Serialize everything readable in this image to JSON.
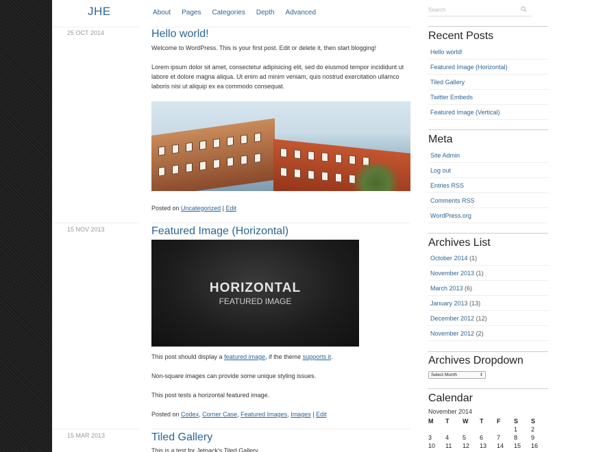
{
  "site": {
    "logo": "JHE"
  },
  "nav": [
    "About",
    "Pages",
    "Categories",
    "Depth",
    "Advanced"
  ],
  "posts": [
    {
      "date": "25 OCT 2014",
      "title": "Hello world!",
      "p1": "Welcome to WordPress. This is your first post. Edit or delete it, then start blogging!",
      "p2": "Lorem ipsum dolor sit amet, consectetur adipisicing elit, sed do eiusmod tempor incididunt ut labore et dolore magna aliqua. Ut enim ad minim veniam, quis nostrud exercitation ullamco laboris nisi ut aliquip ex ea commodo consequat.",
      "posted_on": "Posted on",
      "category": "Uncategorized",
      "sep": "|",
      "edit": "Edit"
    },
    {
      "date": "15 NOV 2013",
      "title": "Featured Image (Horizontal)",
      "image_big": "HORIZONTAL",
      "image_small": "FEATURED IMAGE",
      "p1_a": "This post should display a ",
      "p1_link1": "featured image",
      "p1_b": ", if the theme ",
      "p1_link2": "supports it",
      "p1_c": ".",
      "p2": "Non-square images can provide some unique styling issues.",
      "p3": "This post tests a horizontal featured image.",
      "posted_on": "Posted on",
      "tags": [
        "Codex",
        "Corner Case",
        "Featured Images",
        "Images"
      ],
      "sep": "|",
      "edit": "Edit"
    },
    {
      "date": "15 MAR 2013",
      "title": "Tiled Gallery",
      "p1": "This is a test for Jetpack's Tiled Gallery."
    }
  ],
  "sidebar": {
    "search_placeholder": "Search",
    "recent_title": "Recent Posts",
    "recent": [
      "Hello world!",
      "Featured Image (Horizontal)",
      "Tiled Gallery",
      "Twitter Embeds",
      "Featured Image (Vertical)"
    ],
    "meta_title": "Meta",
    "meta": [
      "Site Admin",
      "Log out",
      "Entries RSS",
      "Comments RSS",
      "WordPress.org"
    ],
    "archives_title": "Archives List",
    "archives": [
      {
        "label": "October 2014",
        "count": "(1)"
      },
      {
        "label": "November 2013",
        "count": "(1)"
      },
      {
        "label": "March 2013",
        "count": "(6)"
      },
      {
        "label": "January 2013",
        "count": "(13)"
      },
      {
        "label": "December 2012",
        "count": "(12)"
      },
      {
        "label": "November 2012",
        "count": "(2)"
      }
    ],
    "dropdown_title": "Archives Dropdown",
    "dropdown_value": "Select Month",
    "calendar_title": "Calendar",
    "calendar_month": "November 2014",
    "calendar_days": [
      "M",
      "T",
      "W",
      "T",
      "F",
      "S",
      "S"
    ],
    "calendar_rows": [
      [
        "",
        "",
        "",
        "",
        "",
        "1",
        "2"
      ],
      [
        "3",
        "4",
        "5",
        "6",
        "7",
        "8",
        "9"
      ],
      [
        "10",
        "11",
        "12",
        "13",
        "14",
        "15",
        "16"
      ]
    ]
  }
}
